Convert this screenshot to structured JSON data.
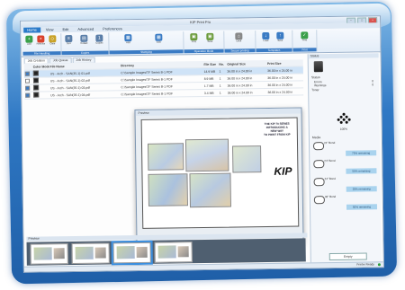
{
  "app": {
    "title": "KIP Print Pro",
    "tabs": [
      "Home",
      "View",
      "Edit",
      "Advanced",
      "Preferences"
    ],
    "active_tab": "Home"
  },
  "ribbon": {
    "groups": [
      {
        "label": "File Handling",
        "buttons": [
          {
            "label": "Add",
            "icon": "add-icon",
            "color": "#3aa04a"
          },
          {
            "label": "Remove",
            "icon": "remove-icon",
            "color": "#d9402b"
          },
          {
            "label": "Clear",
            "icon": "clear-icon",
            "color": "#c9a227"
          }
        ]
      },
      {
        "label": "Copies",
        "buttons": [
          {
            "label": "Sort",
            "icon": "sort-icon",
            "color": "#5a7ea8"
          },
          {
            "label": "Collate",
            "icon": "collate-icon",
            "color": "#5a7ea8"
          },
          {
            "label": "Copies",
            "icon": "copies-icon",
            "color": "#5a7ea8"
          }
        ]
      },
      {
        "label": "Stamping",
        "buttons": [
          {
            "label": "Add",
            "icon": "stamp-icon",
            "color": "#3a7bc4"
          },
          {
            "label": "Edit",
            "icon": "stamp-edit-icon",
            "color": "#3a7bc4"
          }
        ]
      },
      {
        "label": "Operation Mode",
        "buttons": [
          {
            "label": "Print",
            "icon": "print-mode-icon",
            "color": "#6a9a3a"
          },
          {
            "label": "Save",
            "icon": "save-mode-icon",
            "color": "#6a9a3a"
          }
        ]
      },
      {
        "label": "Secure printing",
        "buttons": [
          {
            "label": "Lock",
            "icon": "lock-icon",
            "color": "#888888"
          }
        ]
      },
      {
        "label": "Templates",
        "buttons": [
          {
            "label": "Load",
            "icon": "load-template-icon",
            "color": "#3a7bc4"
          },
          {
            "label": "Save",
            "icon": "save-template-icon",
            "color": "#3a7bc4"
          }
        ]
      },
      {
        "label": "Print",
        "buttons": [
          {
            "label": "Print",
            "icon": "print-icon",
            "color": "#3aa04a"
          }
        ]
      }
    ]
  },
  "pane_tabs": [
    "Job Creation",
    "Job Queue",
    "Job History"
  ],
  "table": {
    "headers": [
      "",
      "Color Mode",
      "File Name",
      "Directory",
      "File Size",
      "No.",
      "Original Size",
      "Print Size"
    ],
    "rows": [
      {
        "checked": true,
        "name": "US - Arch - SAN(35-1)-01.pdf",
        "dir": "C:\\Sample Images\\TF Series B-1 PDF",
        "size": "14.9 MB",
        "no": "1",
        "orig": "36.00 in x 24.00 in",
        "print": "36.00 in x 24.00 in"
      },
      {
        "checked": false,
        "name": "US - Arch - SAN(35-1)-02.pdf",
        "dir": "C:\\Sample Images\\TF Series B-1 PDF",
        "size": "8.9 MB",
        "no": "1",
        "orig": "36.00 in x 24.00 in",
        "print": "36.00 in x 24.00 in"
      },
      {
        "checked": true,
        "name": "US - Arch - SAN(35-1)-03.pdf",
        "dir": "C:\\Sample Images\\TF Series B-1 PDF",
        "size": "1.7 MB",
        "no": "1",
        "orig": "36.00 in x 24.00 in",
        "print": "36.00 in x 24.00 in"
      },
      {
        "checked": true,
        "name": "US - Arch - SAN(35-1)-04.pdf",
        "dir": "C:\\Sample Images\\TF Series B-1 PDF",
        "size": "3.4 MB",
        "no": "1",
        "orig": "36.00 in x 24.00 in",
        "print": "36.00 in x 24.00 in"
      }
    ]
  },
  "preview": {
    "header": "Preview",
    "sheet_title": "THE KIP 70 SERIES\nINTRODUCING A\nNEW WAY\nTO PRINT FROM KIP",
    "brand": "KIP"
  },
  "thumbs_label": "Preview",
  "right_panel": {
    "header": "Status",
    "status_label": "Status",
    "errors_label": "Errors",
    "errors_value": "0",
    "warnings_label": "Warnings",
    "warnings_value": "0",
    "toner_label": "Toner",
    "toner_value": "100%",
    "media_label": "Media",
    "rolls": [
      {
        "name": "24\" Bond",
        "remaining": "75% remaining"
      },
      {
        "name": "24\" Bond",
        "remaining": "50% remaining"
      },
      {
        "name": "24\" Bond",
        "remaining": "25% remaining"
      },
      {
        "name": "36\" Bond",
        "remaining": "50% remaining"
      }
    ],
    "empty_button": "Empty"
  },
  "status_bar": {
    "text": "Printer Ready"
  }
}
